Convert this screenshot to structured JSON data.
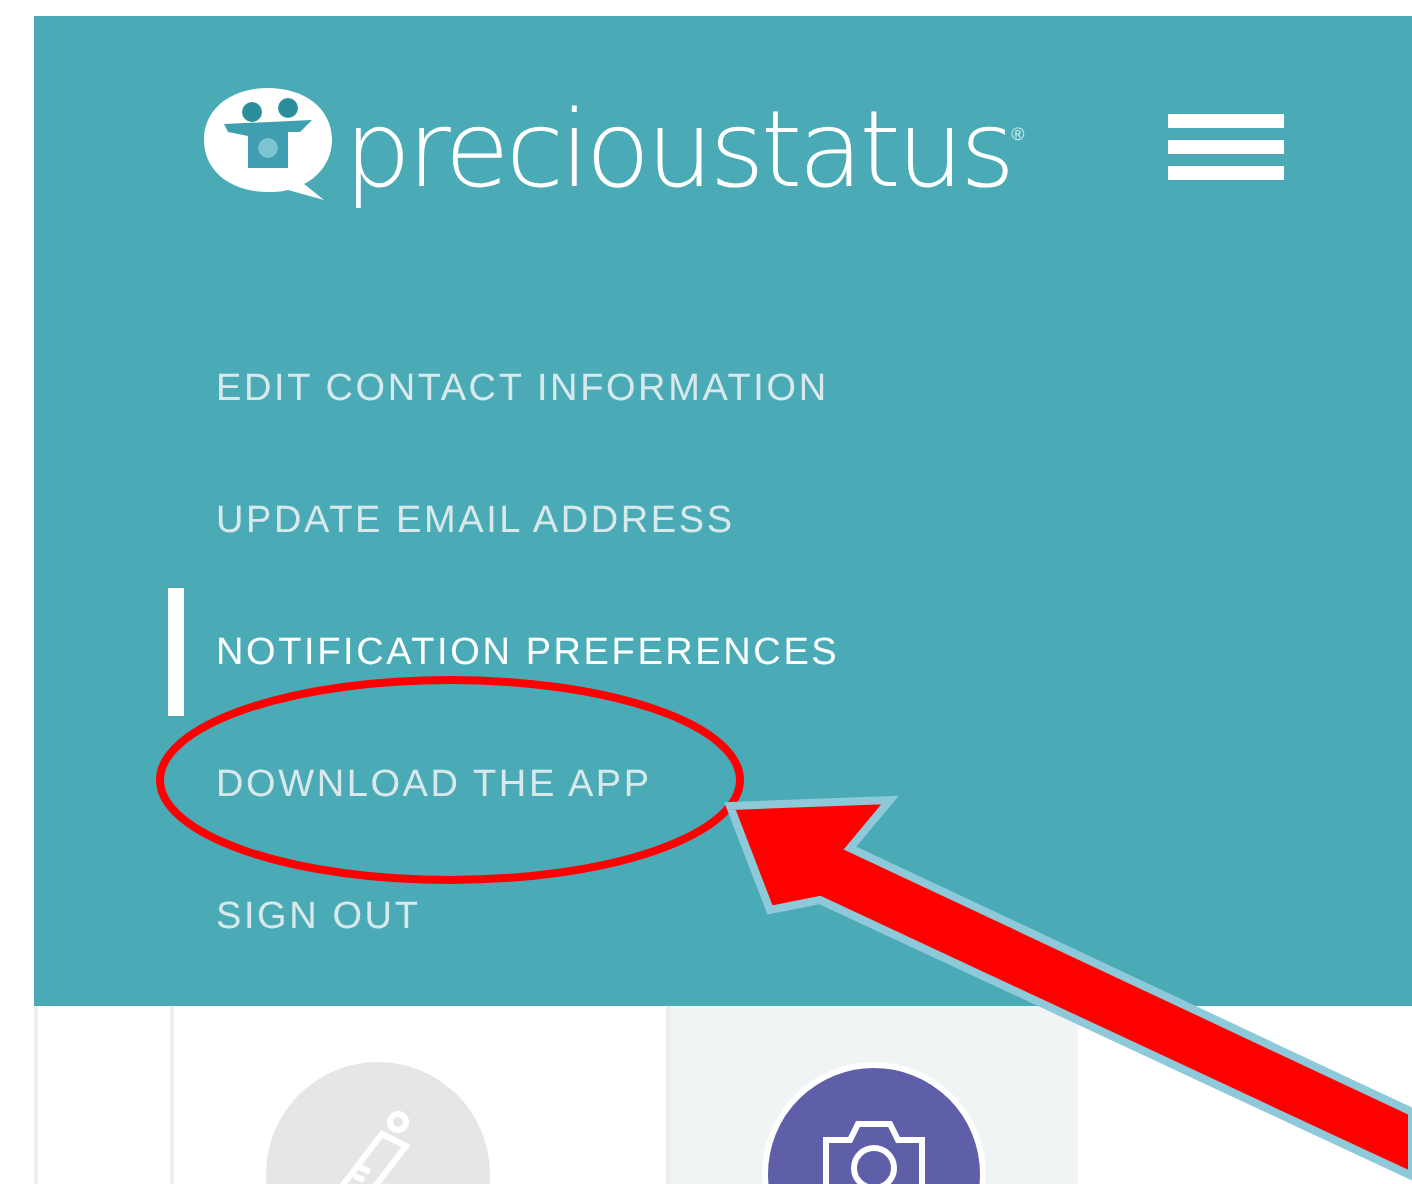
{
  "header": {
    "logo_text": "precioustatus",
    "logo_mark": "®"
  },
  "menu": [
    {
      "label": "EDIT CONTACT INFORMATION",
      "selected": false
    },
    {
      "label": "UPDATE EMAIL ADDRESS",
      "selected": false
    },
    {
      "label": "NOTIFICATION PREFERENCES",
      "selected": true
    },
    {
      "label": "DOWNLOAD THE APP",
      "selected": false
    },
    {
      "label": "SIGN OUT",
      "selected": false
    }
  ],
  "tiles": [
    {
      "kind": "bottle",
      "selected": false
    },
    {
      "kind": "camera",
      "selected": true
    }
  ]
}
